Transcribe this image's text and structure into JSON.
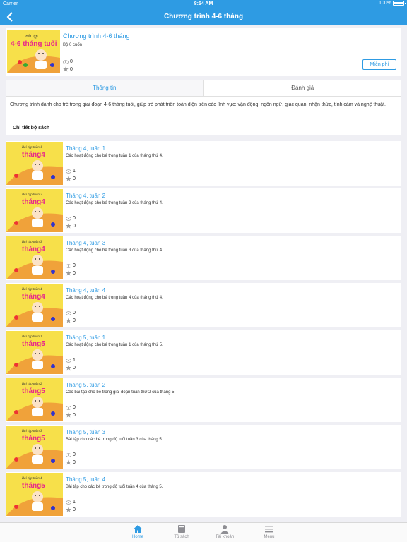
{
  "status": {
    "carrier": "Carrier",
    "time": "8:54 AM",
    "battery": "100%"
  },
  "nav": {
    "title": "Chương trình 4-6 tháng"
  },
  "program": {
    "title": "Chương trình 4-6 tháng",
    "subtitle": "Bộ 0 cuốn",
    "views": "0",
    "rating": "0",
    "price_label": "Miễn phí",
    "cover_text_small": "Bài tập",
    "cover_text_big": "4-6 tháng tuổi"
  },
  "tabs": [
    {
      "label": "Thông tin"
    },
    {
      "label": "Đánh giá"
    }
  ],
  "description": "Chương trình dành cho trẻ trong giai đoạn 4-6 tháng tuổi, giúp trẻ phát triển toàn diện trên các lĩnh vực: vận động, ngôn ngữ, giác quan, nhận thức, tình cảm và nghệ thuật.",
  "detail_title": "Chi tiết bộ sách",
  "books": [
    {
      "title": "Tháng 4, tuần 1",
      "desc": "Các hoạt động cho bé trong tuần 1 của tháng thứ 4.",
      "views": "1",
      "rating": "0",
      "cover_small": "Bài tập tuần 1",
      "cover_big": "tháng4"
    },
    {
      "title": "Tháng 4, tuần 2",
      "desc": "Các hoạt động cho bé trong tuần 2 của tháng thứ 4.",
      "views": "0",
      "rating": "0",
      "cover_small": "Bài tập tuần 2",
      "cover_big": "tháng4"
    },
    {
      "title": "Tháng 4, tuần 3",
      "desc": "Các hoạt động cho bé trong tuần 3 của tháng thứ 4.",
      "views": "0",
      "rating": "0",
      "cover_small": "Bài tập tuần 3",
      "cover_big": "tháng4"
    },
    {
      "title": "Tháng 4, tuần 4",
      "desc": "Các hoạt động cho bé trong tuần 4 của tháng thứ 4.",
      "views": "0",
      "rating": "0",
      "cover_small": "Bài tập tuần 4",
      "cover_big": "tháng4"
    },
    {
      "title": "Tháng 5, tuần 1",
      "desc": "Các hoạt động cho bé trong tuần 1 của tháng thứ 5.",
      "views": "1",
      "rating": "0",
      "cover_small": "Bài tập tuần 1",
      "cover_big": "tháng5"
    },
    {
      "title": "Tháng 5, tuần 2",
      "desc": "Các bài tập cho bé trong giai đoạn tuần thứ 2 của tháng 5.",
      "views": "0",
      "rating": "0",
      "cover_small": "Bài tập tuần 2",
      "cover_big": "tháng5"
    },
    {
      "title": "Tháng 5, tuần 3",
      "desc": "Bài tập cho các bé trong độ tuổi tuần 3 của tháng 5.",
      "views": "0",
      "rating": "0",
      "cover_small": "Bài tập tuần 3",
      "cover_big": "tháng5"
    },
    {
      "title": "Tháng 5, tuần 4",
      "desc": "Bài tập cho các bé trong độ tuổi tuần 4 của tháng 5.",
      "views": "1",
      "rating": "0",
      "cover_small": "Bài tập tuần 4",
      "cover_big": "tháng5"
    }
  ],
  "tabbar": [
    {
      "label": "Home",
      "icon": "home-icon",
      "active": true
    },
    {
      "label": "Tủ sách",
      "icon": "bookshelf-icon",
      "active": false
    },
    {
      "label": "Tài khoản",
      "icon": "account-icon",
      "active": false
    },
    {
      "label": "Menu",
      "icon": "menu-icon",
      "active": false
    }
  ],
  "colors": {
    "accent": "#2e9be3",
    "cover_bg": "#f7e04a",
    "cover_arc": "#f0a23a"
  }
}
